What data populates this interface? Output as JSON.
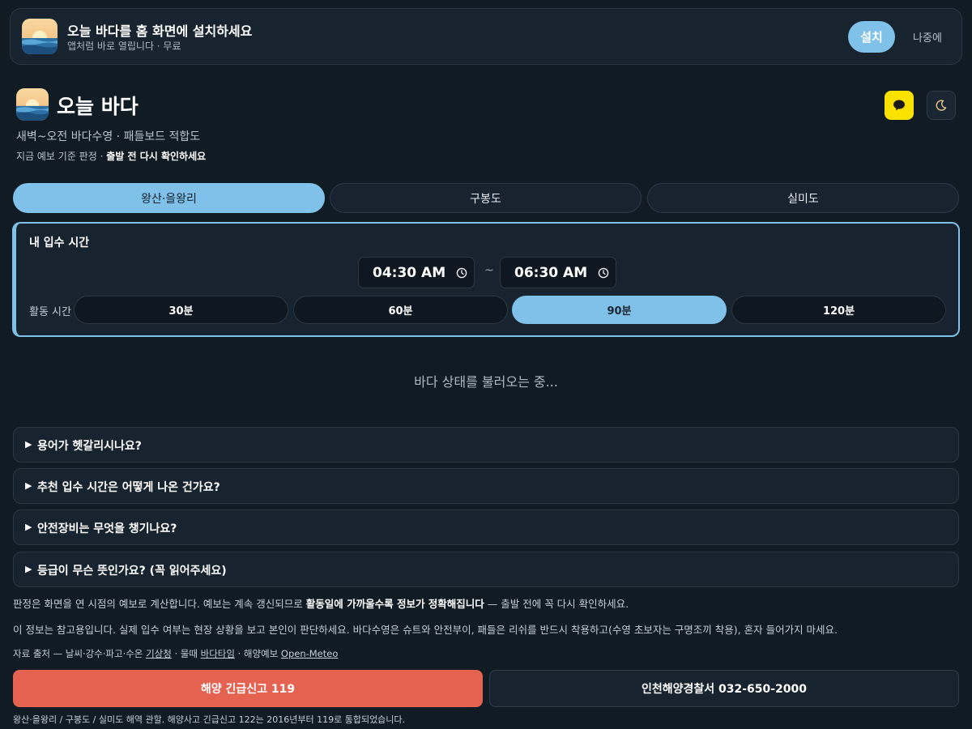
{
  "install_banner": {
    "title": "오늘 바다를 홈 화면에 설치하세요",
    "subtitle": "앱처럼 바로 열립니다 · 무료",
    "install_label": "설치",
    "later_label": "나중에",
    "icon": "sunrise-sea-icon"
  },
  "header": {
    "title": "오늘 바다",
    "subtitle": "새벽~오전 바다수영 · 패들보드 적합도",
    "note_prefix": "지금 예보 기준 판정 · ",
    "note_bold": "출발 전 다시 확인하세요",
    "kakao_icon": "kakao-chat-icon",
    "theme_icon": "moon-icon"
  },
  "locations": {
    "tabs": [
      {
        "label": "왕산·을왕리",
        "active": true
      },
      {
        "label": "구봉도",
        "active": false
      },
      {
        "label": "실미도",
        "active": false
      }
    ]
  },
  "entry": {
    "title": "내 입수 시간",
    "start_time": "04:30 AM",
    "separator": "~",
    "end_time": "06:30 AM",
    "duration_label": "활동 시간",
    "durations": [
      {
        "label": "30분",
        "active": false
      },
      {
        "label": "60분",
        "active": false
      },
      {
        "label": "90분",
        "active": true
      },
      {
        "label": "120분",
        "active": false
      }
    ]
  },
  "status": {
    "loading": "바다 상태를 불러오는 중..."
  },
  "faq": [
    {
      "question": "용어가 헷갈리시나요?"
    },
    {
      "question": "추천 입수 시간은 어떻게 나온 건가요?"
    },
    {
      "question": "안전장비는 무엇을 챙기나요?"
    },
    {
      "question": "등급이 무슨 뜻인가요? (꼭 읽어주세요)"
    }
  ],
  "info": {
    "line1_prefix": "판정은 화면을 연 시점의 예보로 계산합니다. 예보는 계속 갱신되므로 ",
    "line1_bold": "활동일에 가까울수록 정보가 정확해집니다",
    "line1_suffix": " — 출발 전에 꼭 다시 확인하세요.",
    "line2": "이 정보는 참고용입니다. 실제 입수 여부는 현장 상황을 보고 본인이 판단하세요. 바다수영은 슈트와 안전부이, 패들은 리쉬를 반드시 착용하고(수영 초보자는 구명조끼 착용), 혼자 들어가지 마세요."
  },
  "sources": {
    "prefix": "자료 출처 — 날씨·강수·파고·수온 ",
    "kma": "기상청",
    "mid1": " · 물때 ",
    "badatime": "바다타임",
    "mid2": " · 해양예보 ",
    "openmeteo": "Open-Meteo"
  },
  "emergency": {
    "label": "해양 긴급신고 119",
    "police_label": "인천해양경찰서 032-650-2000",
    "footer": "왕산·을왕리 / 구봉도 / 실미도 해역 관할. 해양사고 긴급신고 122는 2016년부터 119로 통합되었습니다."
  },
  "colors": {
    "background": "#111b24",
    "accent": "#7fc1e8",
    "emergency": "#e56150",
    "kakao": "#fae100"
  }
}
